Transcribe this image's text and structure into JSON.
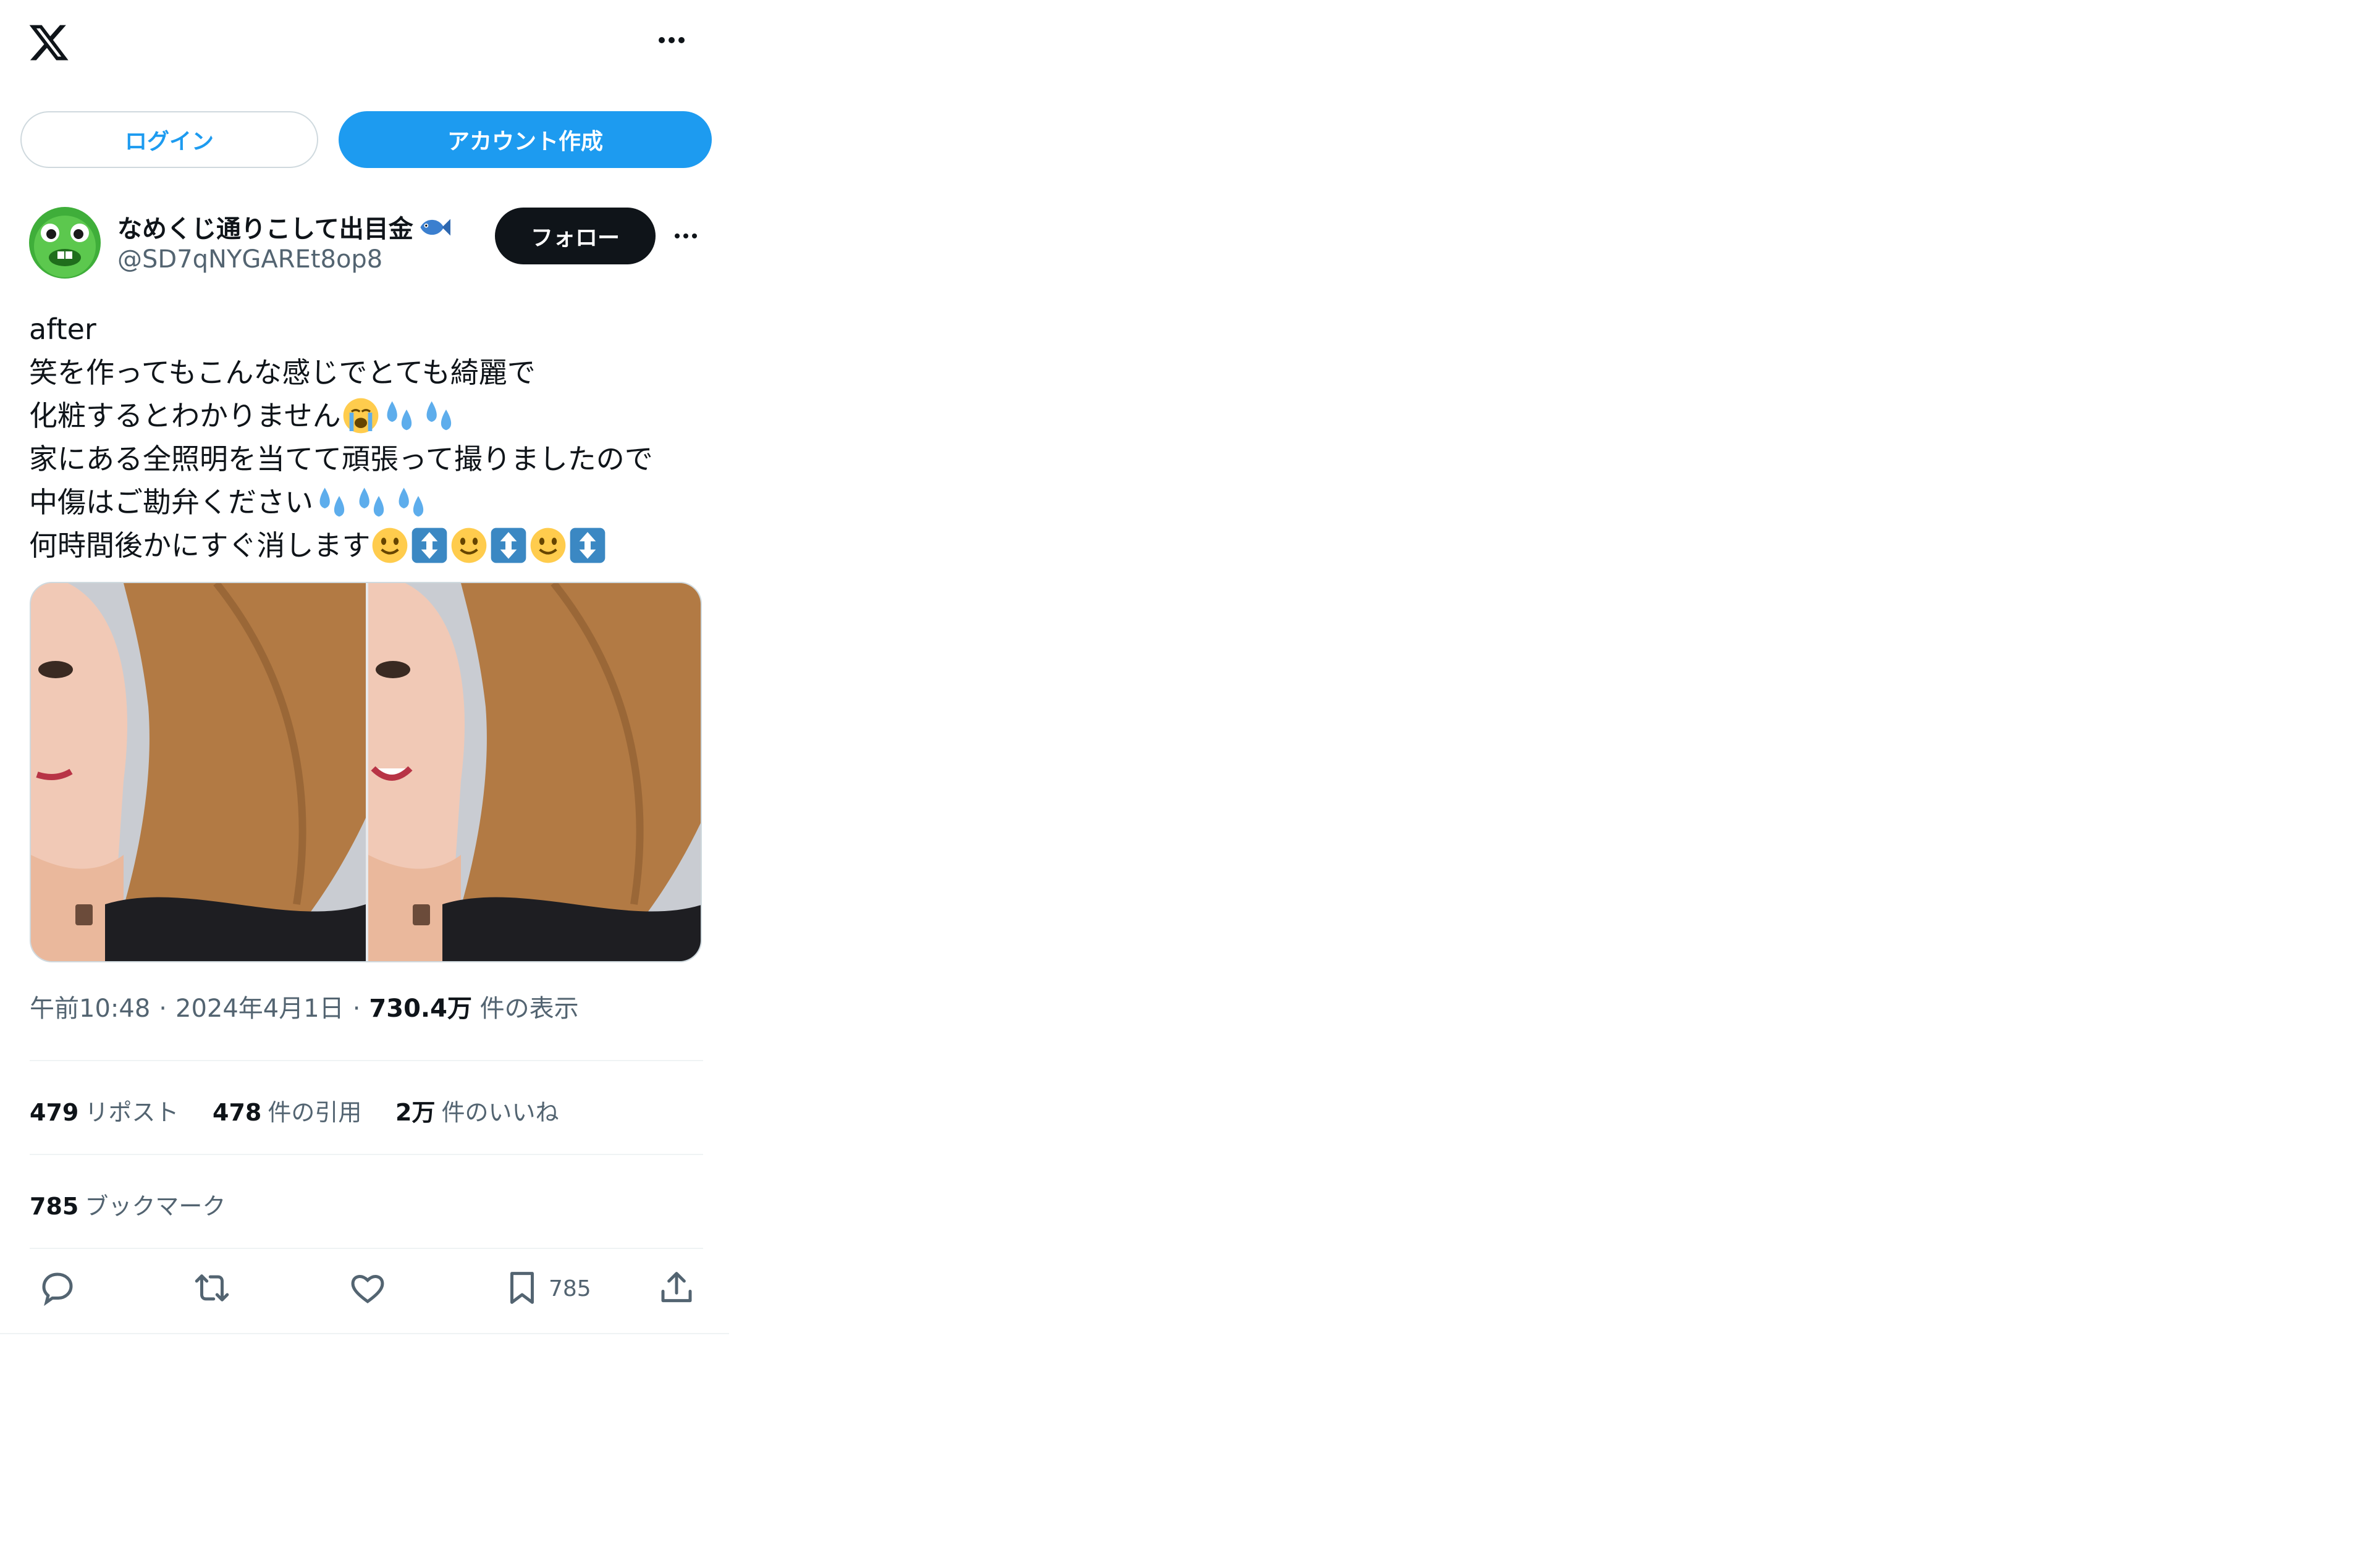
{
  "header": {
    "logo_icon": "x-logo-icon",
    "more_icon": "more-horizontal-icon"
  },
  "auth": {
    "login_label": "ログイン",
    "signup_label": "アカウント作成"
  },
  "author": {
    "display_name": "なめくじ通りこして出目金",
    "handle": "@SD7qNYGAREt8op8",
    "follow_label": "フォロー",
    "avatar_icon": "green-monster-avatar",
    "name_emoji": "fish-icon"
  },
  "tweet": {
    "lines": [
      "after",
      "笑を作ってもこんな感じでとても綺麗で",
      "化粧するとわかりません",
      "家にある全照明を当てて頑張って撮りましたので",
      "中傷はご勘弁ください",
      "何時間後かにすぐ消します"
    ],
    "emoji": {
      "line3": [
        "loudly-crying-face-icon",
        "sweat-droplets-icon",
        "sweat-droplets-icon"
      ],
      "line5": [
        "sweat-droplets-icon",
        "sweat-droplets-icon",
        "sweat-droplets-icon"
      ],
      "line6": [
        "slightly-smiling-face-icon",
        "up-down-arrow-icon",
        "slightly-smiling-face-icon",
        "up-down-arrow-icon",
        "slightly-smiling-face-icon",
        "up-down-arrow-icon"
      ]
    }
  },
  "meta": {
    "time": "午前10:48",
    "separator": "·",
    "date": "2024年4月1日",
    "views": "730.4万",
    "views_label": "件の表示"
  },
  "stats": {
    "reposts": "479",
    "reposts_label": "リポスト",
    "quotes": "478",
    "quotes_label": "件の引用",
    "likes": "2万",
    "likes_label": "件のいいね",
    "bookmarks": "785",
    "bookmarks_label": "ブックマーク"
  },
  "actions": {
    "bookmark_count": "785"
  },
  "colors": {
    "accent": "#1d9bf0",
    "text": "#0f1419",
    "muted": "#536471",
    "border": "#cfd9de"
  }
}
